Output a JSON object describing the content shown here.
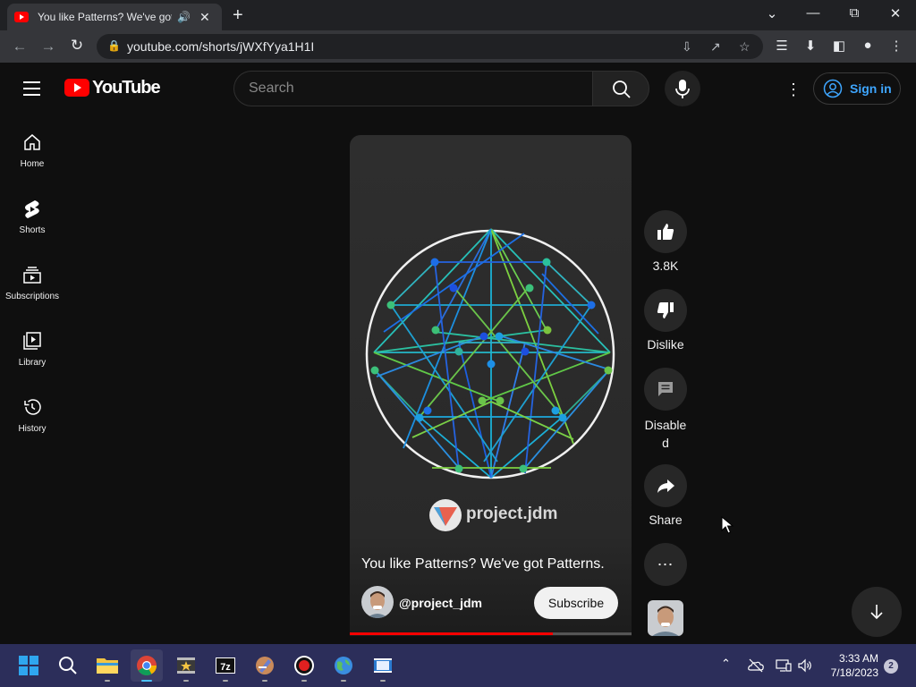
{
  "browser": {
    "tab_title": "You like Patterns? We've got Patterns.",
    "url": "youtube.com/shorts/jWXfYya1H1I"
  },
  "masthead": {
    "logo_text": "YouTube",
    "search_placeholder": "Search",
    "signin_label": "Sign in"
  },
  "sidebar": {
    "items": [
      {
        "label": "Home",
        "icon": "home-icon"
      },
      {
        "label": "Shorts",
        "icon": "shorts-icon"
      },
      {
        "label": "Subscriptions",
        "icon": "subscriptions-icon"
      },
      {
        "label": "Library",
        "icon": "library-icon"
      },
      {
        "label": "History",
        "icon": "history-icon"
      }
    ]
  },
  "short": {
    "title": "You like Patterns? We've got Patterns.",
    "watermark": "project.jdm",
    "channel_handle": "@project_jdm",
    "subscribe_label": "Subscribe",
    "progress": 0.72
  },
  "actions": {
    "like_count": "3.8K",
    "dislike_label": "Dislike",
    "comments_label": "Disable\nd",
    "share_label": "Share"
  },
  "taskbar": {
    "time": "3:33 AM",
    "date": "7/18/2023",
    "notifications": "2",
    "apps": [
      "start-icon",
      "search-icon",
      "file-explorer-icon",
      "chrome-icon",
      "movie-maker-icon",
      "7zip-icon",
      "app-icon",
      "recorder-icon",
      "globe-icon",
      "film-icon"
    ]
  },
  "colors": {
    "youtube_red": "#ff0000",
    "link_blue": "#3ea6ff",
    "taskbar": "#2c2e5a"
  }
}
